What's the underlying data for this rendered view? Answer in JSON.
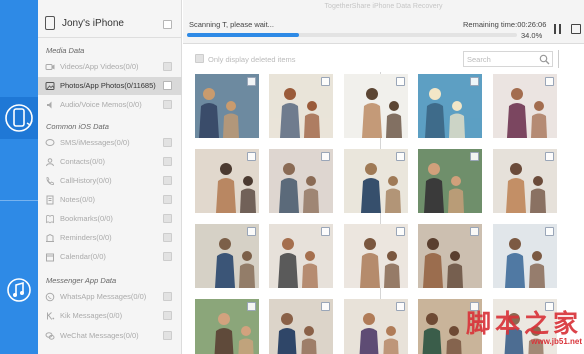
{
  "app": {
    "title": "TogetherShare iPhone Data Recovery"
  },
  "rail": {
    "items": [
      {
        "icon": "phone-refresh-icon",
        "active": true
      },
      {
        "icon": "music-refresh-icon",
        "active": false
      }
    ]
  },
  "device": {
    "name": "Jony's iPhone",
    "icon": "iphone-icon"
  },
  "sections": [
    {
      "title": "Media Data",
      "items": [
        {
          "label": "Videos/App Videos(0/0)",
          "icon": "video-icon",
          "selected": false
        },
        {
          "label": "Photos/App Photos(0/11685)",
          "icon": "photo-icon",
          "selected": true
        },
        {
          "label": "Audio/Voice Memos(0/0)",
          "icon": "audio-icon",
          "selected": false
        }
      ]
    },
    {
      "title": "Common iOS Data",
      "items": [
        {
          "label": "SMS/iMessages(0/0)",
          "icon": "message-icon",
          "selected": false
        },
        {
          "label": "Contacts(0/0)",
          "icon": "contacts-icon",
          "selected": false
        },
        {
          "label": "CallHistory(0/0)",
          "icon": "phone-icon",
          "selected": false
        },
        {
          "label": "Notes(0/0)",
          "icon": "notes-icon",
          "selected": false
        },
        {
          "label": "Bookmarks(0/0)",
          "icon": "bookmark-icon",
          "selected": false
        },
        {
          "label": "Reminders(0/0)",
          "icon": "reminder-icon",
          "selected": false
        },
        {
          "label": "Calendar(0/0)",
          "icon": "calendar-icon",
          "selected": false
        }
      ]
    },
    {
      "title": "Messenger App Data",
      "items": [
        {
          "label": "WhatsApp Messages(0/0)",
          "icon": "whatsapp-icon",
          "selected": false
        },
        {
          "label": "Kik Messages(0/0)",
          "icon": "kik-icon",
          "selected": false
        },
        {
          "label": "WeChat Messages(0/0)",
          "icon": "wechat-icon",
          "selected": false
        }
      ]
    }
  ],
  "scan": {
    "status": "Scanning T, please wait...",
    "remaining": "Remaining time:00:26:06",
    "percent_label": "34.0%",
    "progress": 0.34
  },
  "filter": {
    "label": "Only display deleted items"
  },
  "search": {
    "placeholder": "Search"
  },
  "photo_count": 20,
  "watermark": {
    "big": "脚本之家",
    "small": "www.jb51.net"
  },
  "colors": {
    "accent": "#2e8ae6",
    "sidebar_bg": "#f5f5f5",
    "selected_row": "#d9d9d9",
    "watermark": "#d9343a"
  }
}
